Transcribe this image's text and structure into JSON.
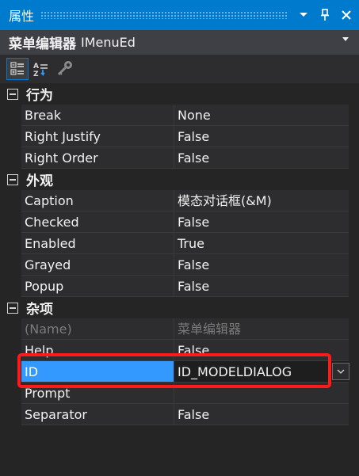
{
  "window": {
    "title": "属性",
    "buttons": {
      "dropdown_icon": "chevron-down-icon",
      "pin_icon": "pin-icon",
      "close_icon": "close-icon"
    }
  },
  "object_selector": {
    "name": "菜单编辑器",
    "type": "IMenuEd"
  },
  "toolbar": {
    "items": [
      "categorized-icon",
      "alphabetical-icon",
      "property-pages-icon"
    ]
  },
  "categories": [
    {
      "label": "行为",
      "rows": [
        {
          "name": "Break",
          "value": "None"
        },
        {
          "name": "Right Justify",
          "value": "False"
        },
        {
          "name": "Right Order",
          "value": "False"
        }
      ]
    },
    {
      "label": "外观",
      "rows": [
        {
          "name": "Caption",
          "value": "模态对话框(&M)"
        },
        {
          "name": "Checked",
          "value": "False"
        },
        {
          "name": "Enabled",
          "value": "True"
        },
        {
          "name": "Grayed",
          "value": "False"
        },
        {
          "name": "Popup",
          "value": "False"
        }
      ]
    },
    {
      "label": "杂项",
      "rows": [
        {
          "name": "(Name)",
          "value": "菜单编辑器"
        },
        {
          "name": "Help",
          "value": "False"
        },
        {
          "name": "ID",
          "value": "ID_MODELDIALOG"
        },
        {
          "name": "Prompt",
          "value": ""
        },
        {
          "name": "Separator",
          "value": "False"
        }
      ]
    }
  ],
  "colors": {
    "accent": "#007acc",
    "selection": "#3399ff",
    "highlight_box": "#ff1a1a"
  }
}
